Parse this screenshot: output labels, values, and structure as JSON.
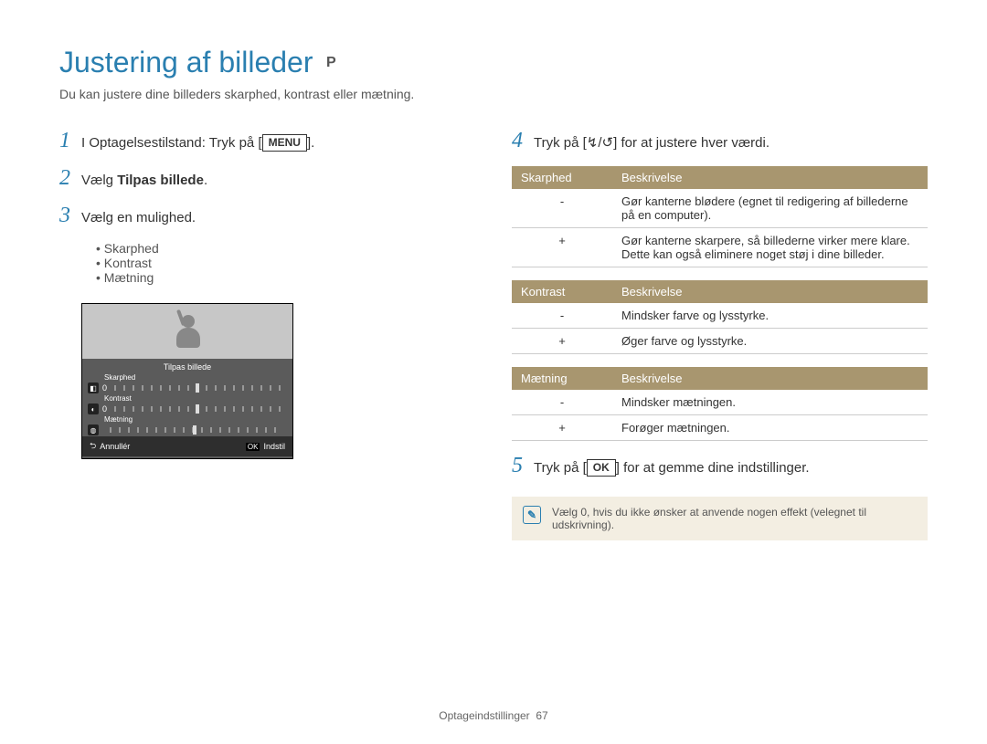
{
  "title": "Justering af billeder",
  "mode_badge": "P",
  "subtitle": "Du kan justere dine billeders skarphed, kontrast eller mætning.",
  "step1": {
    "pre": "I Optagelsestilstand: Tryk på [",
    "btn": "MENU",
    "post": "]."
  },
  "step2": {
    "pre": "Vælg ",
    "bold": "Tilpas billede",
    "post": "."
  },
  "step3": "Vælg en mulighed.",
  "step3_bullets": [
    "Skarphed",
    "Kontrast",
    "Mætning"
  ],
  "screen": {
    "title": "Tilpas billede",
    "rows": [
      {
        "label": "Skarphed",
        "val": "0"
      },
      {
        "label": "Kontrast",
        "val": "0"
      },
      {
        "label": "Mætning",
        "val": ""
      }
    ],
    "cancel": "Annullér",
    "ok_key": "OK",
    "set": "Indstil"
  },
  "step4": {
    "pre": "Tryk på [",
    "arrows": "↯/↺",
    "post": "] for at justere hver værdi."
  },
  "table_sharp": {
    "h1": "Skarphed",
    "h2": "Beskrivelse",
    "rows": [
      {
        "k": "-",
        "v": "Gør kanterne blødere (egnet til redigering af billederne på en computer)."
      },
      {
        "k": "+",
        "v": "Gør kanterne skarpere, så billederne virker mere klare. Dette kan også eliminere noget støj i dine billeder."
      }
    ]
  },
  "table_contrast": {
    "h1": "Kontrast",
    "h2": "Beskrivelse",
    "rows": [
      {
        "k": "-",
        "v": "Mindsker farve og lysstyrke."
      },
      {
        "k": "+",
        "v": "Øger farve og lysstyrke."
      }
    ]
  },
  "table_sat": {
    "h1": "Mætning",
    "h2": "Beskrivelse",
    "rows": [
      {
        "k": "-",
        "v": "Mindsker mætningen."
      },
      {
        "k": "+",
        "v": "Forøger mætningen."
      }
    ]
  },
  "step5": {
    "pre": "Tryk på [",
    "btn": "OK",
    "post": "] for at gemme dine indstillinger."
  },
  "note": "Vælg 0, hvis du ikke ønsker at anvende nogen effekt (velegnet til udskrivning).",
  "footer_section": "Optageindstillinger",
  "footer_page": "67"
}
